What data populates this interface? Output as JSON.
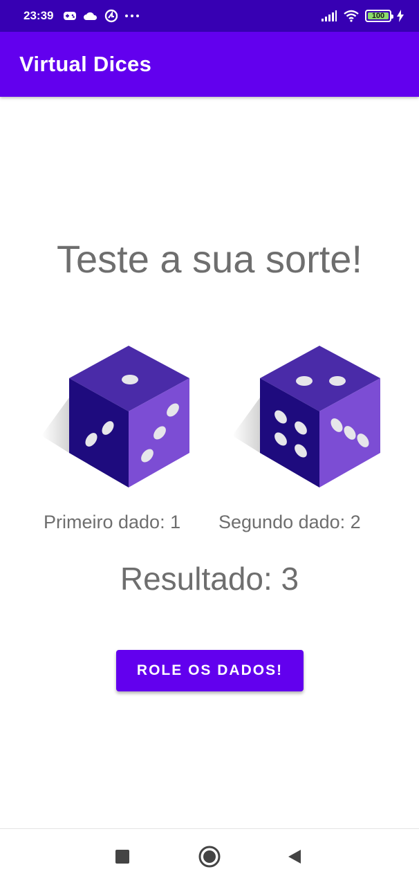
{
  "status_bar": {
    "time": "23:39",
    "battery_level": "100",
    "icons": [
      "game-controller-icon",
      "cloud-icon",
      "sync-icon",
      "more-icon",
      "signal-icon",
      "wifi-icon",
      "battery-icon",
      "charging-icon"
    ]
  },
  "app_bar": {
    "title": "Virtual Dices"
  },
  "main": {
    "headline": "Teste a sua sorte!",
    "dice": [
      {
        "label": "Primeiro dado: 1",
        "top_face": 1,
        "left_face": 2,
        "right_face": 3
      },
      {
        "label": "Segundo dado: 2",
        "top_face": 2,
        "left_face": 4,
        "right_face": 3
      }
    ],
    "result": "Resultado: 3",
    "roll_button_label": "ROLE OS DADOS!"
  },
  "colors": {
    "status_bar": "#3700b3",
    "app_bar": "#6200ee",
    "button": "#6200ee",
    "text_gray": "#6e6e6e",
    "die_top": "#4a2ba8",
    "die_left": "#1e0b7e",
    "die_right": "#7c4dd4",
    "pip": "#e6e6ea"
  },
  "nav_bar": {
    "buttons": [
      "recents-button",
      "home-button",
      "back-button"
    ]
  }
}
